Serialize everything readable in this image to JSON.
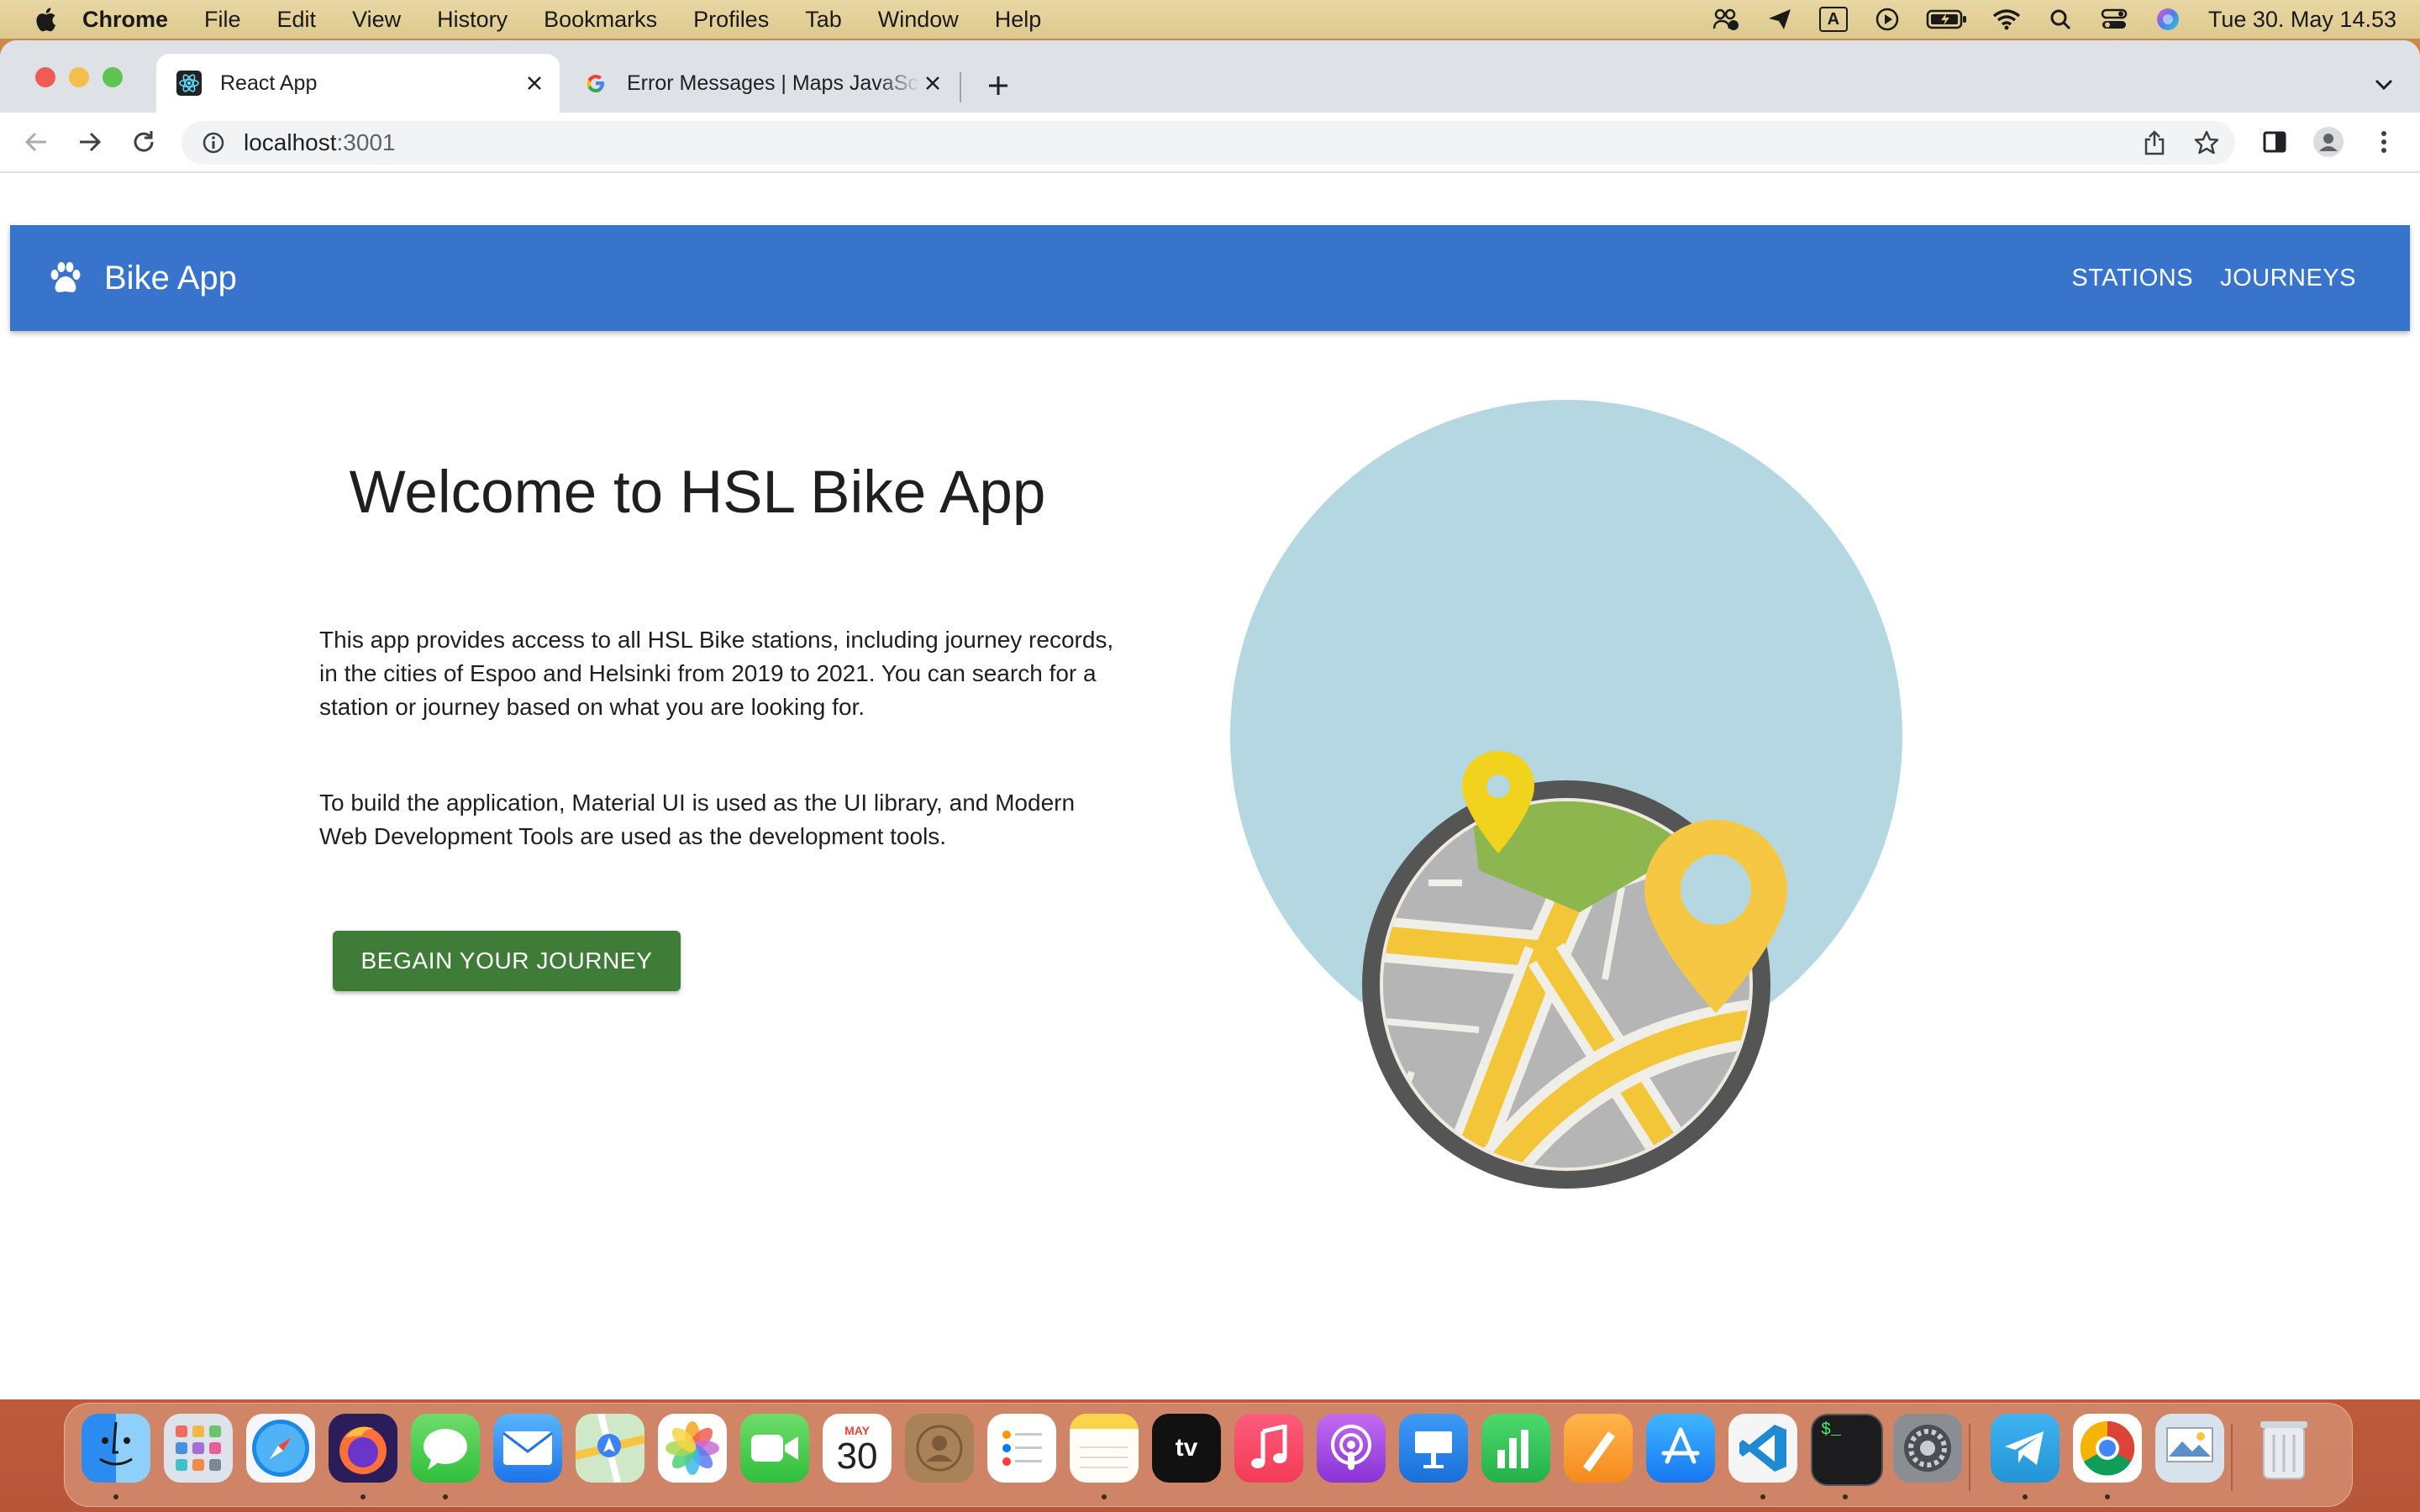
{
  "menubar": {
    "app_name": "Chrome",
    "items": [
      "File",
      "Edit",
      "View",
      "History",
      "Bookmarks",
      "Profiles",
      "Tab",
      "Window",
      "Help"
    ],
    "clock": "Tue 30. May  14.53",
    "status_icons": [
      "meeting-icon",
      "send-icon",
      "input-source-icon",
      "play-icon",
      "battery-icon",
      "wifi-icon",
      "search-icon",
      "control-center-icon",
      "siri-icon"
    ],
    "input_source_label": "A"
  },
  "browser": {
    "tabs": [
      {
        "title": "React App",
        "favicon": "react-icon"
      },
      {
        "title": "Error Messages  |  Maps JavaScript API",
        "favicon": "google-icon"
      }
    ],
    "url": {
      "host": "localhost",
      "port": ":3001"
    }
  },
  "app": {
    "brand": "Bike App",
    "nav": {
      "stations": "STATIONS",
      "journeys": "JOURNEYS"
    },
    "heading": "Welcome to HSL Bike App",
    "paragraph1": "This app provides access to all HSL Bike stations, including journey records, in the cities of Espoo and Helsinki from 2019 to 2021. You can search for a station or journey based on what you are looking for.",
    "paragraph2": "To build the application, Material UI is used as the UI library, and Modern Web Development Tools are used as the development tools.",
    "cta": "BEGAIN YOUR JOURNEY",
    "colors": {
      "appbar": "#3874cb",
      "cta": "#3e7c37",
      "hero_circle": "#b4d7e2",
      "pin_yellow": "#f5c743",
      "pin_small": "#f1d21c"
    }
  },
  "dock": {
    "apps": [
      "Finder",
      "Launchpad",
      "Safari",
      "Firefox",
      "Messages",
      "Mail",
      "Maps",
      "Photos",
      "FaceTime",
      "Calendar",
      "Contacts",
      "Reminders",
      "Notes",
      "TV",
      "Music",
      "Podcasts",
      "Keynote",
      "Numbers",
      "Pages",
      "App Store",
      "Visual Studio Code",
      "Terminal",
      "System Preferences",
      "Telegram",
      "Chrome",
      "Preview",
      "Trash"
    ],
    "calendar_month": "MAY",
    "calendar_day": "30",
    "tv_label": "tv",
    "terminal_prompt": "$_"
  }
}
